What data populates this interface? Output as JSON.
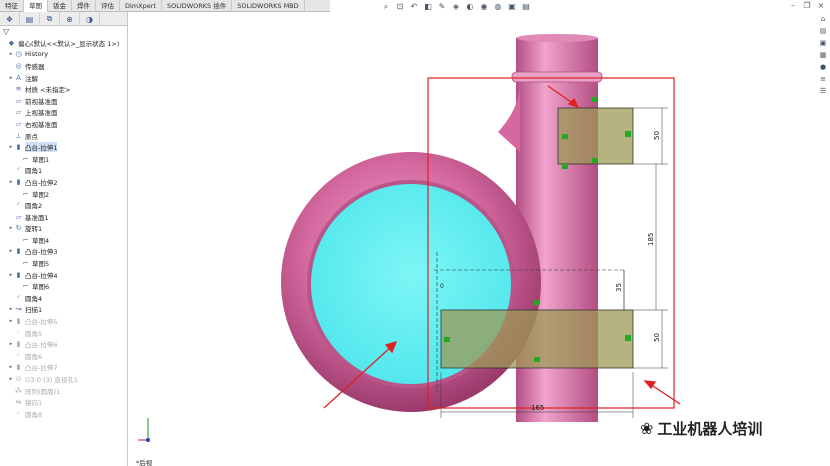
{
  "command_tabs": [
    "特征",
    "草图",
    "钣金",
    "焊件",
    "评估",
    "DimXpert",
    "SOLIDWORKS 插件",
    "SOLIDWORKS MBD"
  ],
  "active_tab_index": 1,
  "hud_icons": [
    "zoom-fit-icon",
    "zoom-area-icon",
    "previous-view-icon",
    "section-view-icon",
    "dynamic-annotation-icon",
    "view-orientation-icon",
    "display-style-icon",
    "hide-show-icon",
    "edit-appearance-icon",
    "apply-scene-icon",
    "view-settings-icon"
  ],
  "panel_tabs": [
    "feature-manager-icon",
    "property-manager-icon",
    "configuration-manager-icon",
    "dimxpert-manager-icon",
    "display-manager-icon"
  ],
  "tree": [
    {
      "label": "偏心(默认<<默认>_显示状态 1>)",
      "icon": "part-icon",
      "arrow": false,
      "indent": 0,
      "state": "normal"
    },
    {
      "label": "History",
      "icon": "history-icon",
      "arrow": true,
      "indent": 1,
      "state": "normal"
    },
    {
      "label": "传感器",
      "icon": "sensor-icon",
      "arrow": false,
      "indent": 1,
      "state": "normal"
    },
    {
      "label": "注解",
      "icon": "annotation-icon",
      "arrow": true,
      "indent": 1,
      "state": "normal"
    },
    {
      "label": "材质 <未指定>",
      "icon": "material-icon",
      "arrow": false,
      "indent": 1,
      "state": "normal"
    },
    {
      "label": "前视基准面",
      "icon": "plane-icon",
      "arrow": false,
      "indent": 1,
      "state": "normal"
    },
    {
      "label": "上视基准面",
      "icon": "plane-icon",
      "arrow": false,
      "indent": 1,
      "state": "normal"
    },
    {
      "label": "右视基准面",
      "icon": "plane-icon",
      "arrow": false,
      "indent": 1,
      "state": "normal"
    },
    {
      "label": "原点",
      "icon": "origin-icon",
      "arrow": false,
      "indent": 1,
      "state": "normal"
    },
    {
      "label": "凸台-拉伸1",
      "icon": "extrude-icon",
      "arrow": true,
      "indent": 1,
      "state": "selected"
    },
    {
      "label": "草图1",
      "icon": "sketch-icon",
      "arrow": false,
      "indent": 2,
      "state": "normal"
    },
    {
      "label": "圆角1",
      "icon": "fillet-icon",
      "arrow": false,
      "indent": 1,
      "state": "normal"
    },
    {
      "label": "凸台-拉伸2",
      "icon": "extrude-icon",
      "arrow": true,
      "indent": 1,
      "state": "normal"
    },
    {
      "label": "草图2",
      "icon": "sketch-icon",
      "arrow": false,
      "indent": 2,
      "state": "normal"
    },
    {
      "label": "圆角2",
      "icon": "fillet-icon",
      "arrow": false,
      "indent": 1,
      "state": "normal"
    },
    {
      "label": "基准面1",
      "icon": "plane-icon",
      "arrow": false,
      "indent": 1,
      "state": "normal"
    },
    {
      "label": "旋转1",
      "icon": "revolve-icon",
      "arrow": true,
      "indent": 1,
      "state": "normal"
    },
    {
      "label": "草图4",
      "icon": "sketch-icon",
      "arrow": false,
      "indent": 2,
      "state": "normal"
    },
    {
      "label": "凸台-拉伸3",
      "icon": "extrude-icon",
      "arrow": true,
      "indent": 1,
      "state": "normal"
    },
    {
      "label": "草图5",
      "icon": "sketch-icon",
      "arrow": false,
      "indent": 2,
      "state": "normal"
    },
    {
      "label": "凸台-拉伸4",
      "icon": "extrude-icon",
      "arrow": true,
      "indent": 1,
      "state": "normal"
    },
    {
      "label": "草图6",
      "icon": "sketch-icon",
      "arrow": false,
      "indent": 2,
      "state": "normal"
    },
    {
      "label": "圆角4",
      "icon": "fillet-icon",
      "arrow": false,
      "indent": 1,
      "state": "normal"
    },
    {
      "label": "扫描1",
      "icon": "sweep-icon",
      "arrow": true,
      "indent": 1,
      "state": "normal"
    },
    {
      "label": "凸台-拉伸5",
      "icon": "extrude-icon",
      "arrow": true,
      "indent": 1,
      "state": "dim"
    },
    {
      "label": "圆角5",
      "icon": "fillet-icon",
      "arrow": false,
      "indent": 1,
      "state": "dim"
    },
    {
      "label": "凸台-拉伸6",
      "icon": "extrude-icon",
      "arrow": true,
      "indent": 1,
      "state": "dim"
    },
    {
      "label": "圆角6",
      "icon": "fillet-icon",
      "arrow": false,
      "indent": 1,
      "state": "dim"
    },
    {
      "label": "凸台-拉伸7",
      "icon": "extrude-icon",
      "arrow": true,
      "indent": 1,
      "state": "dim"
    },
    {
      "label": "∅3.0 (3) 直径孔1",
      "icon": "hole-icon",
      "arrow": true,
      "indent": 1,
      "state": "dim"
    },
    {
      "label": "阵列(圆周)1",
      "icon": "pattern-icon",
      "arrow": false,
      "indent": 1,
      "state": "dim"
    },
    {
      "label": "镜向1",
      "icon": "mirror-icon",
      "arrow": false,
      "indent": 1,
      "state": "dim"
    },
    {
      "label": "圆角8",
      "icon": "fillet-icon",
      "arrow": false,
      "indent": 1,
      "state": "dim"
    }
  ],
  "dimensions": {
    "top_rect_height": "50",
    "middle_span": "185",
    "offset": "35",
    "bottom_rect_height": "50",
    "overall_width": "165",
    "origin_label": "0"
  },
  "view_label": "*后视",
  "watermark": "工业机器人培训",
  "colors": {
    "body_pink": "#d4689f",
    "face_cyan": "#5ef0f0",
    "sketch_olive": "#9c9a55",
    "annotation_red": "#e02020",
    "relation_green": "#22aa22"
  }
}
